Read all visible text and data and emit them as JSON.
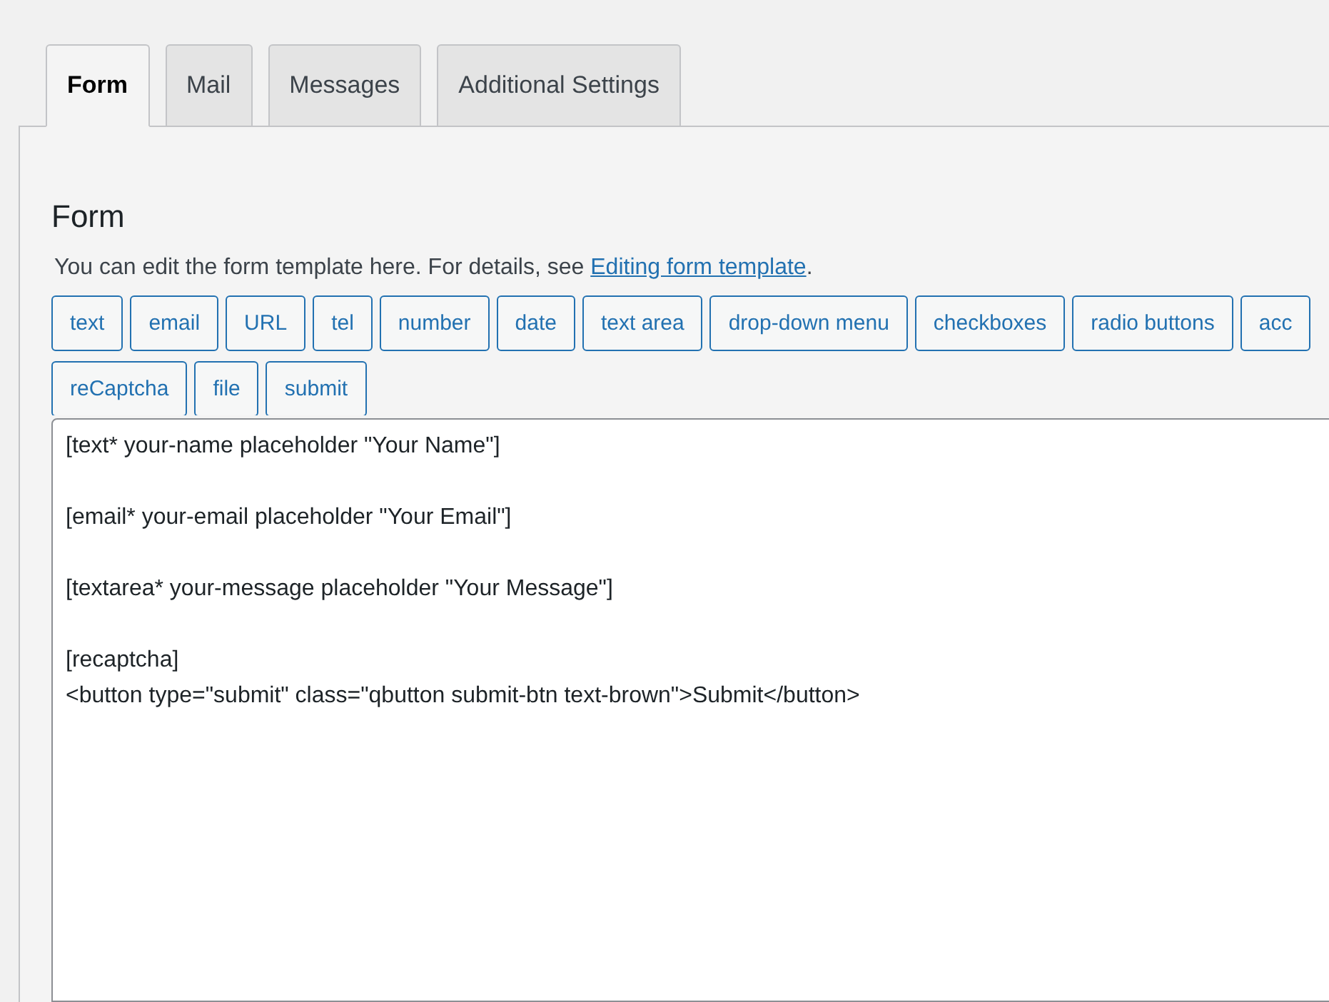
{
  "tabs": [
    {
      "label": "Form",
      "selected": true
    },
    {
      "label": "Mail",
      "selected": false
    },
    {
      "label": "Messages",
      "selected": false
    },
    {
      "label": "Additional Settings",
      "selected": false
    }
  ],
  "panel": {
    "title": "Form",
    "description": {
      "text": "You can edit the form template here. For details, see ",
      "link": "Editing form template",
      "end": "."
    },
    "tag_buttons": [
      "text",
      "email",
      "URL",
      "tel",
      "number",
      "date",
      "text area",
      "drop-down menu",
      "checkboxes",
      "radio buttons",
      "acc",
      "reCaptcha",
      "file",
      "submit"
    ],
    "template": {
      "value": "[text* your-name placeholder \"Your Name\"]\n\n[email* your-email placeholder \"Your Email\"]\n\n[textarea* your-message placeholder \"Your Message\"]\n\n[recaptcha]\n<button type=\"submit\" class=\"qbutton submit-btn text-brown\">Submit</button>"
    }
  }
}
